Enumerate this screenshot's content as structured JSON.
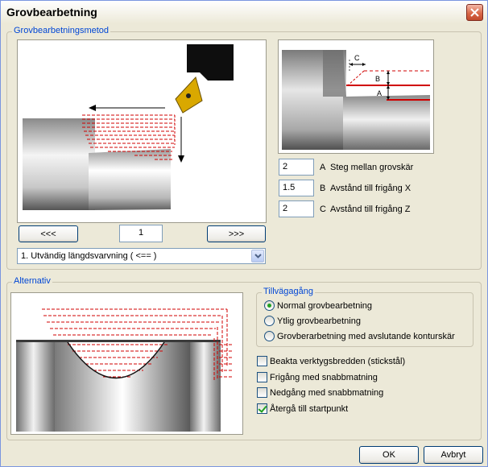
{
  "window": {
    "title": "Grovbearbetning"
  },
  "method_group": {
    "legend": "Grovbearbetningsmetod",
    "prev_label": "<<<",
    "next_label": ">>>",
    "page_number": "1",
    "method_select": "1. Utvändig längdsvarvning ( <== )",
    "params": [
      {
        "value": "2",
        "letter": "A",
        "label": "Steg mellan grovskär"
      },
      {
        "value": "1.5",
        "letter": "B",
        "label": "Avstånd till frigång X"
      },
      {
        "value": "2",
        "letter": "C",
        "label": "Avstånd till frigång Z"
      }
    ],
    "diagram_letters": {
      "a": "A",
      "b": "B",
      "c": "C"
    }
  },
  "options_group": {
    "legend": "Alternativ",
    "procedure": {
      "legend": "Tillvägagång",
      "options": [
        {
          "label": "Normal grovbearbetning",
          "checked": true
        },
        {
          "label": "Ytlig grovbearbetning",
          "checked": false
        },
        {
          "label": "Grovberarbetning med avslutande konturskär",
          "checked": false
        }
      ]
    },
    "checks": [
      {
        "label": "Beakta verktygsbredden (stickstål)",
        "checked": false
      },
      {
        "label": "Frigång med snabbmatning",
        "checked": false
      },
      {
        "label": "Nedgång med snabbmatning",
        "checked": false
      },
      {
        "label": "Återgå till startpunkt",
        "checked": true
      }
    ]
  },
  "footer": {
    "ok_label": "OK",
    "cancel_label": "Avbryt"
  },
  "colors": {
    "accent": "#0046d5",
    "toolpath": "#d00000"
  }
}
